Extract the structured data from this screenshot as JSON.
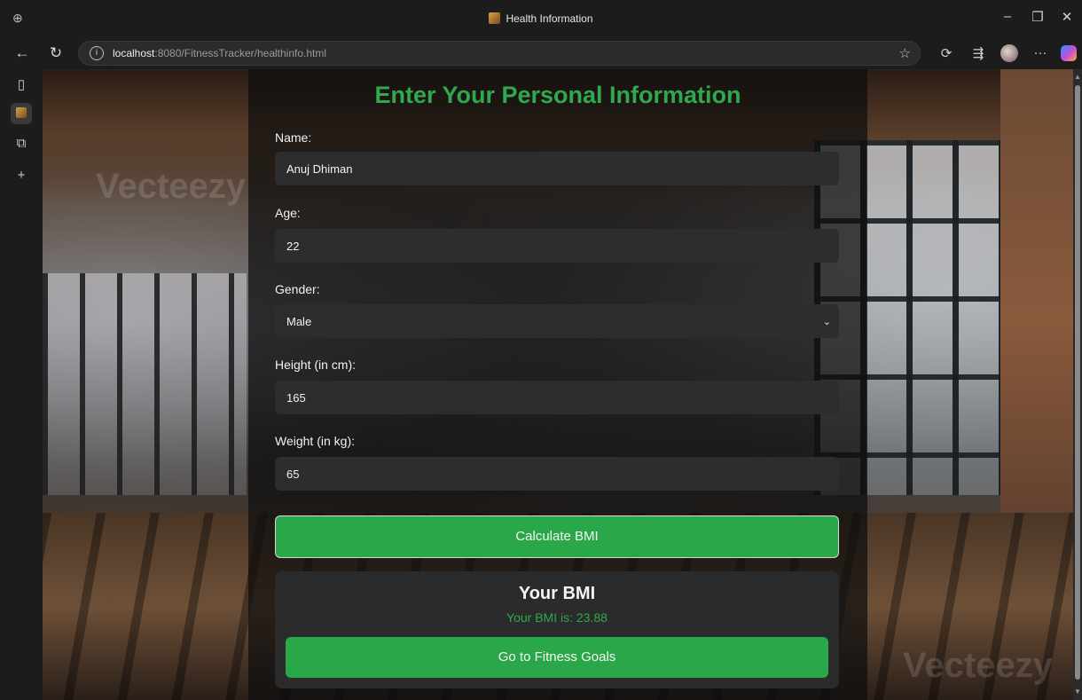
{
  "browser": {
    "tab_title": "Health Information",
    "url_host": "localhost",
    "url_path": ":8080/FitnessTracker/healthinfo.html",
    "icons": {
      "app": "workspaces-icon",
      "back": "back-arrow-icon",
      "refresh": "refresh-icon",
      "info": "info-icon",
      "favorite": "star-icon",
      "extensions": "extensions-icon",
      "favorites_bar": "favorites-icon",
      "more": "more-icon",
      "minimize": "minimize-icon",
      "restore": "restore-icon",
      "close": "close-icon"
    },
    "window_controls": {
      "minimize": "–",
      "restore": "❐",
      "close": "✕"
    },
    "glyphs": {
      "back": "←",
      "refresh": "↻",
      "info": "i",
      "star": "☆",
      "ext": "⟳",
      "fav": "⇶",
      "more": "···",
      "tabs": "▯",
      "collections": "⧉",
      "add": "+",
      "app": "⊕"
    }
  },
  "form": {
    "heading": "Enter Your Personal Information",
    "fields": [
      {
        "label": "Name:",
        "value": "Anuj Dhiman"
      },
      {
        "label": "Age:",
        "value": "22"
      },
      {
        "label": "Gender:",
        "value": "Male"
      },
      {
        "label": "Height (in cm):",
        "value": "165"
      },
      {
        "label": "Weight (in kg):",
        "value": "65"
      }
    ],
    "calculate_label": "Calculate BMI"
  },
  "result": {
    "title": "Your BMI",
    "value_text": "Your BMI is: 23.88",
    "goals_label": "Go to Fitness Goals"
  },
  "colors": {
    "accent": "#2aa748",
    "heading": "#2fa84f",
    "input_bg": "#2d2d2d"
  },
  "watermark": "Vecteezy"
}
